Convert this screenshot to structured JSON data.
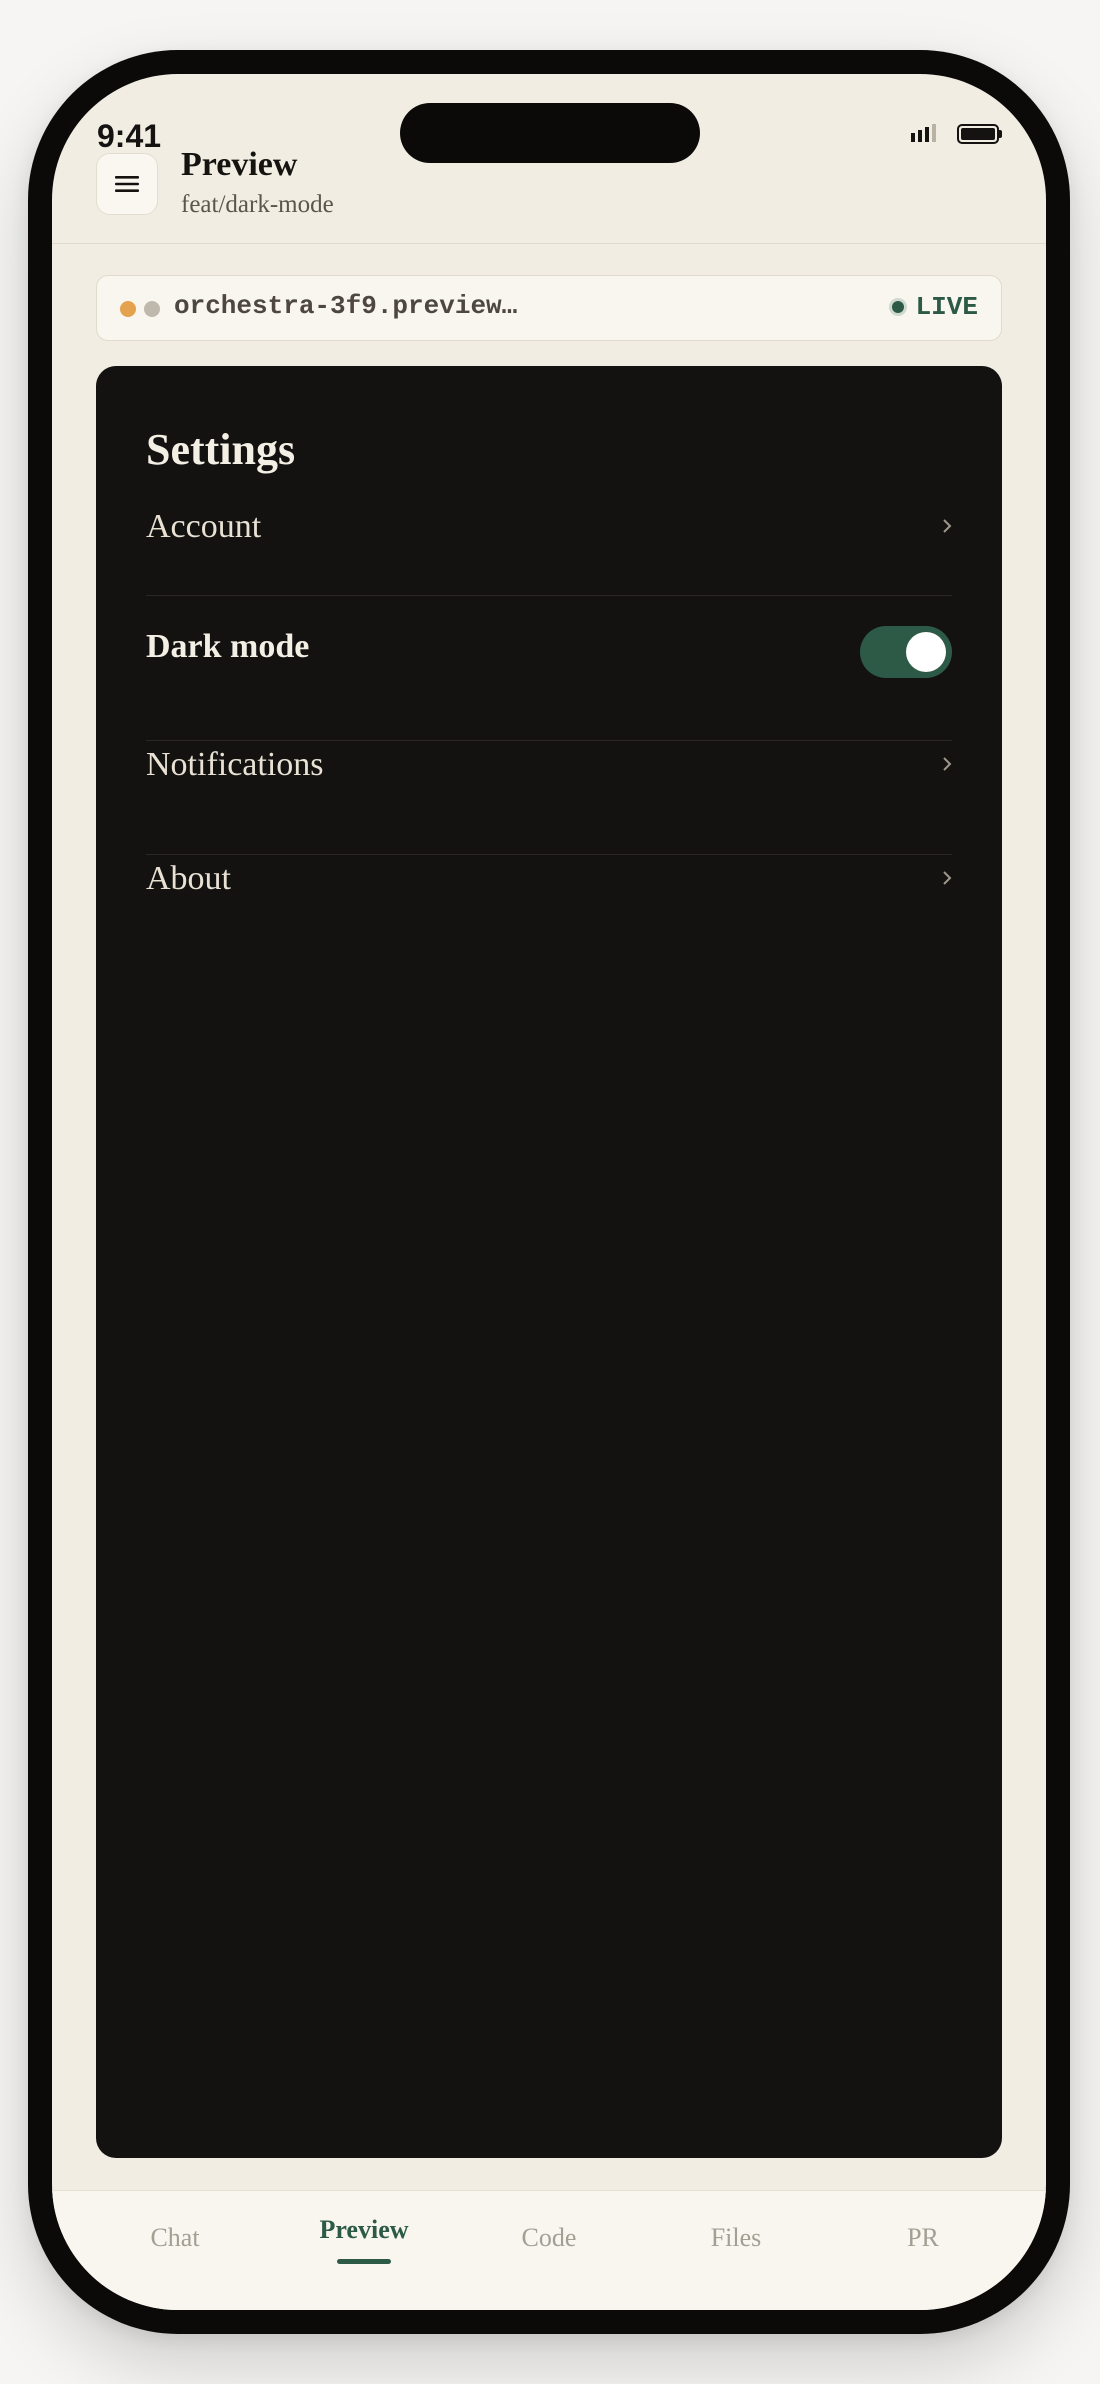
{
  "status_bar": {
    "time": "9:41"
  },
  "header": {
    "title": "Preview",
    "subtitle": "feat/dark-mode",
    "menu_icon": "hamburger-icon"
  },
  "url_bar": {
    "url": "orchestra-3f9.preview…",
    "status": "LIVE",
    "dot_colors": [
      "#e4a24f",
      "#bfb8ac"
    ]
  },
  "preview": {
    "title": "Settings",
    "items": [
      {
        "label": "Account",
        "control": "chevron"
      },
      {
        "label": "Dark mode",
        "control": "toggle",
        "enabled": true
      },
      {
        "label": "Notifications",
        "control": "chevron"
      },
      {
        "label": "About",
        "control": "chevron"
      }
    ]
  },
  "tabs": [
    {
      "label": "Chat",
      "active": false
    },
    {
      "label": "Preview",
      "active": true
    },
    {
      "label": "Code",
      "active": false
    },
    {
      "label": "Files",
      "active": false
    },
    {
      "label": "PR",
      "active": false
    }
  ],
  "colors": {
    "accent": "#2d5a47",
    "background": "#f1ede3",
    "preview_background": "#131211"
  }
}
